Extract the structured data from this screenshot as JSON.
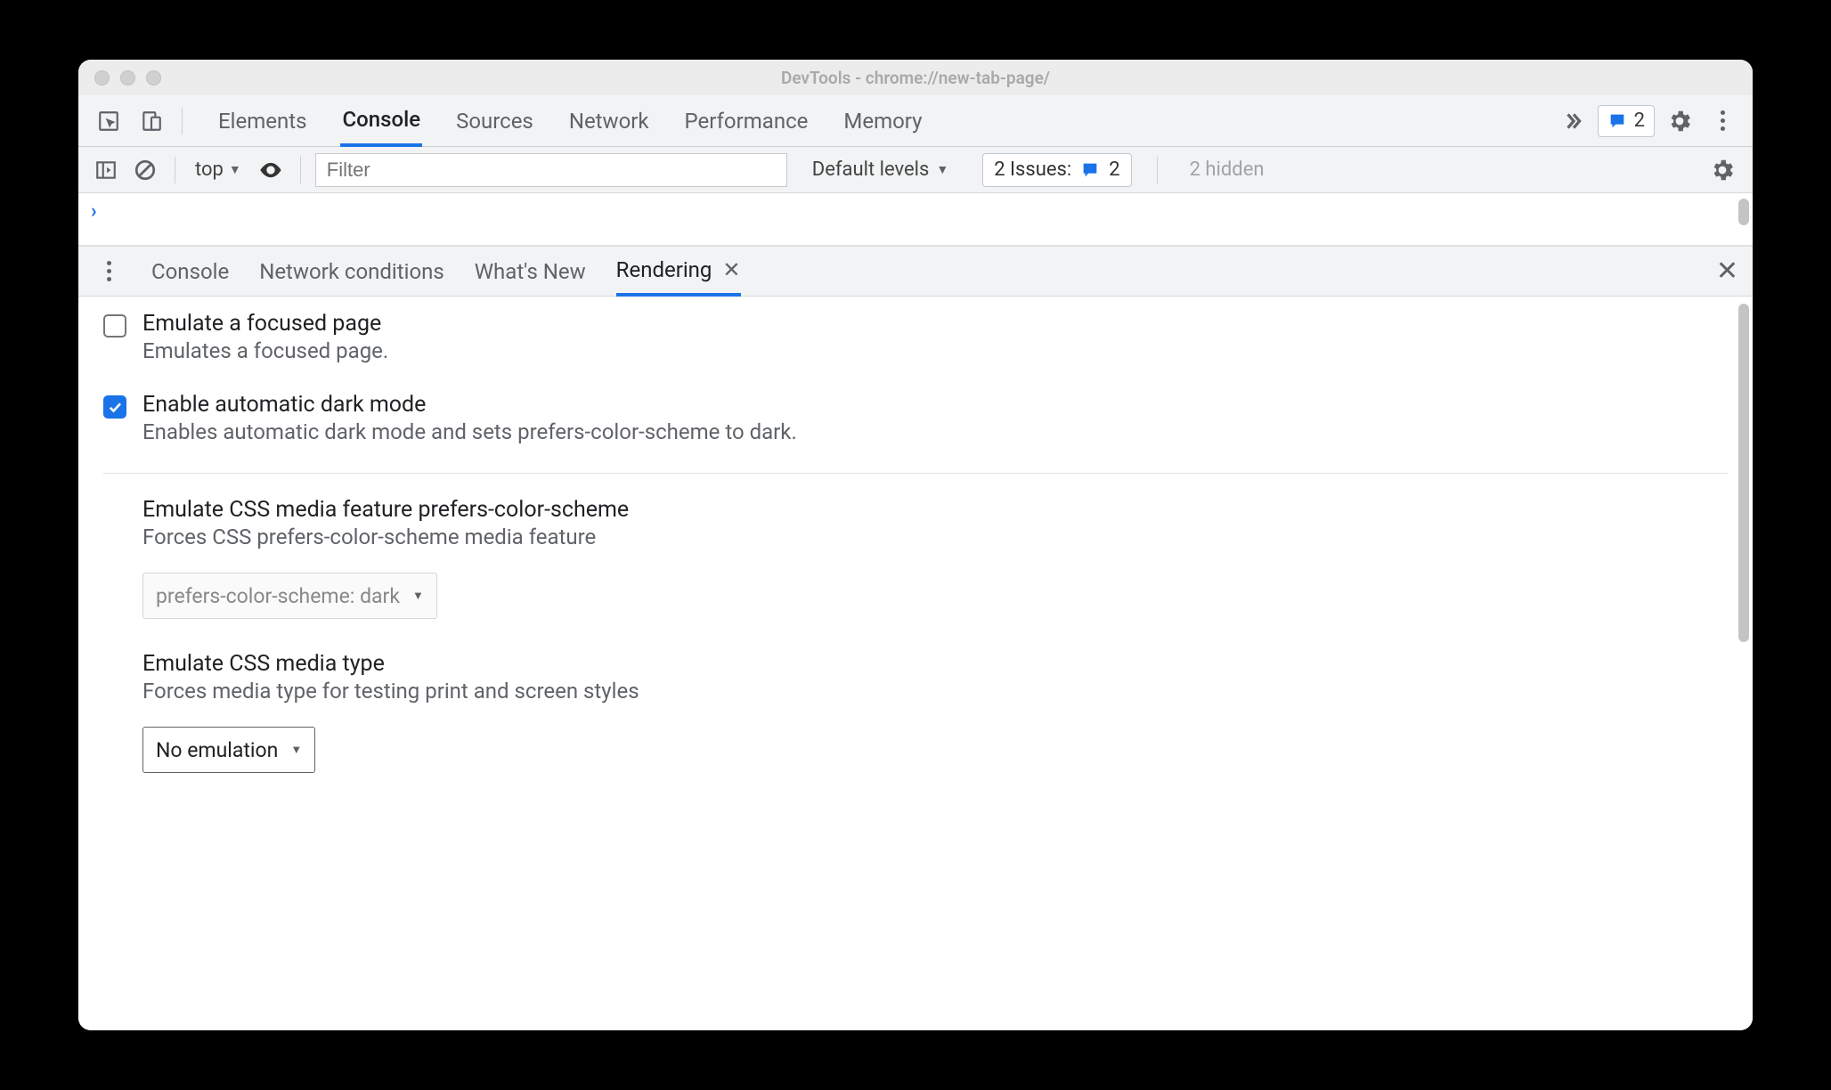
{
  "window": {
    "title": "DevTools - chrome://new-tab-page/"
  },
  "tabs": {
    "items": [
      "Elements",
      "Console",
      "Sources",
      "Network",
      "Performance",
      "Memory"
    ],
    "active_index": 1,
    "issue_badge_count": "2"
  },
  "console_toolbar": {
    "context": "top",
    "filter_placeholder": "Filter",
    "levels": "Default levels",
    "issues_label": "2 Issues:",
    "issues_count": "2",
    "hidden_text": "2 hidden"
  },
  "drawer": {
    "tabs": [
      "Console",
      "Network conditions",
      "What's New",
      "Rendering"
    ],
    "active_index": 3
  },
  "render": {
    "opt1": {
      "title": "Emulate a focused page",
      "desc": "Emulates a focused page.",
      "checked": false
    },
    "opt2": {
      "title": "Enable automatic dark mode",
      "desc": "Enables automatic dark mode and sets prefers-color-scheme to dark.",
      "checked": true
    },
    "sec1": {
      "title": "Emulate CSS media feature prefers-color-scheme",
      "desc": "Forces CSS prefers-color-scheme media feature",
      "select": "prefers-color-scheme: dark"
    },
    "sec2": {
      "title": "Emulate CSS media type",
      "desc": "Forces media type for testing print and screen styles",
      "select": "No emulation"
    }
  }
}
